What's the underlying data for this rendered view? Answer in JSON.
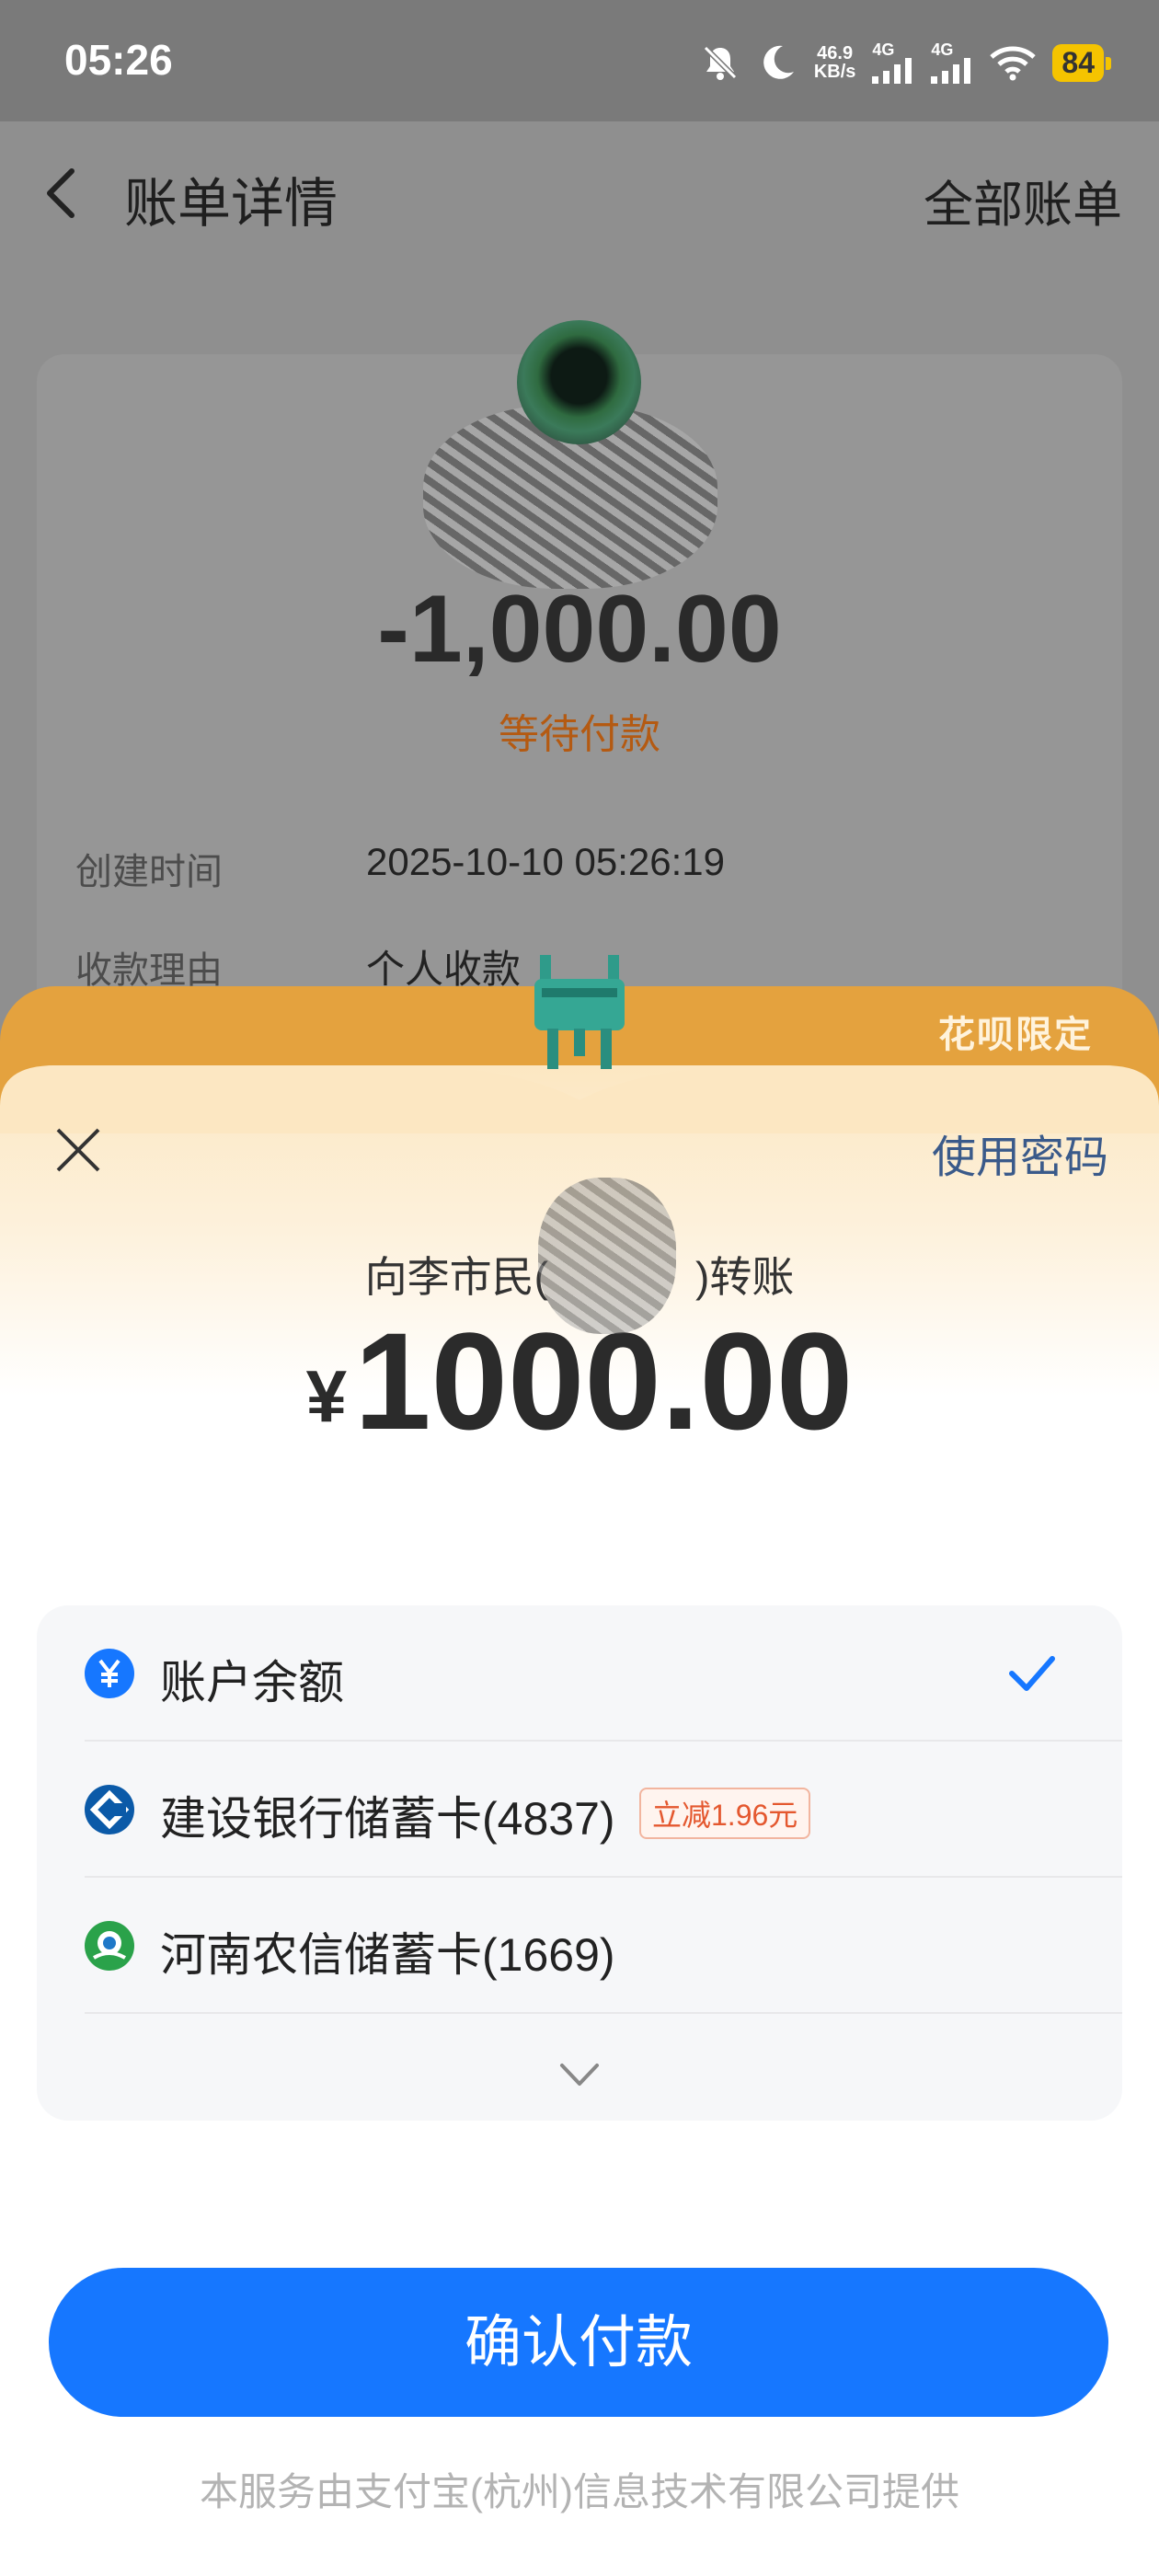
{
  "status_bar": {
    "time": "05:26",
    "net_speed": "46.9",
    "net_unit": "KB/s",
    "signal_1": "4G",
    "signal_2": "4G",
    "battery": "84"
  },
  "header": {
    "title": "账单详情",
    "all_bills": "全部账单"
  },
  "bill": {
    "amount": "-1,000.00",
    "status": "等待付款",
    "details": [
      {
        "label": "创建时间",
        "value": "2025-10-10 05:26:19"
      },
      {
        "label": "收款理由",
        "value": "个人收款"
      }
    ]
  },
  "sheet": {
    "promo_label": "花呗限定",
    "use_password": "使用密码",
    "payee": "向李市民(",
    "payee_suffix": ")转账",
    "currency": "¥",
    "amount": "1000.00"
  },
  "methods": [
    {
      "label": "账户余额",
      "icon": "balance-yuan-icon",
      "selected": true
    },
    {
      "label": "建设银行储蓄卡(4837)",
      "icon": "ccb-bank-icon",
      "badge": "立减1.96元"
    },
    {
      "label": "河南农信储蓄卡(1669)",
      "icon": "henan-rural-credit-icon"
    }
  ],
  "colors": {
    "accent_blue": "#1677ff",
    "promo_orange": "#e4a23e",
    "status_orange": "#b45a12"
  },
  "confirm": "确认付款",
  "footer": "本服务由支付宝(杭州)信息技术有限公司提供"
}
